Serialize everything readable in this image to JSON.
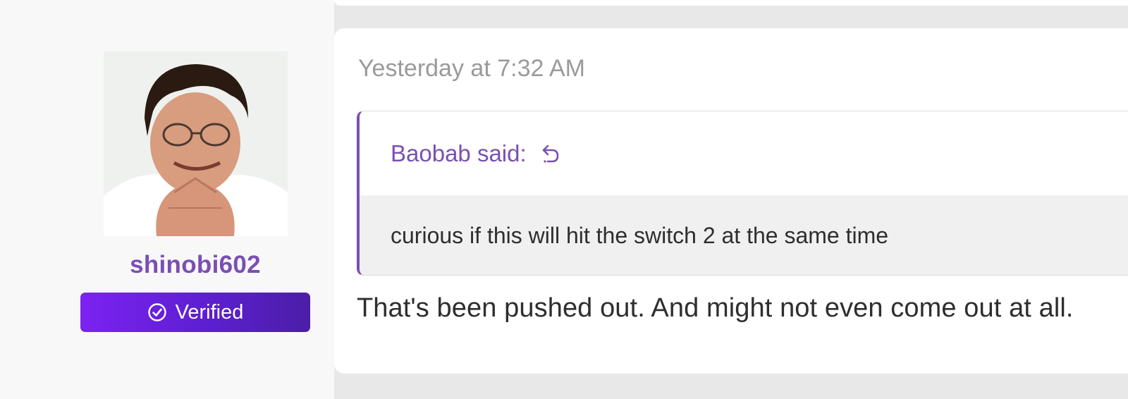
{
  "user": {
    "username": "shinobi602",
    "badge_label": "Verified",
    "badge_icon": "check-circle-icon",
    "avatar_alt": "User avatar"
  },
  "post": {
    "timestamp": "Yesterday at 7:32 AM",
    "quote": {
      "author_label": "Baobab said:",
      "reply_icon": "reply-arrow-icon",
      "text": "curious if this will hit the switch 2 at the same time"
    },
    "message": "That's been pushed out. And might not even come out at all."
  },
  "colors": {
    "accent": "#7a4fb4",
    "badge_start": "#7c22f2",
    "badge_end": "#4b1ea8",
    "text": "#2e2e2e",
    "muted": "#9a9a9a"
  }
}
